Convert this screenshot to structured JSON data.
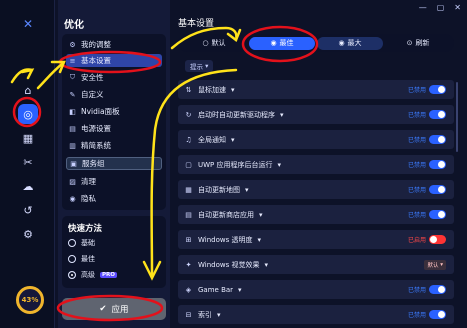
{
  "window": {
    "minimize": "—",
    "maximize": "▢",
    "close": "✕"
  },
  "rail": {
    "logo": "✕",
    "percent": "43%"
  },
  "menu": {
    "title": "优化",
    "items": [
      {
        "label": "我的调整",
        "icon": "gear-icon"
      },
      {
        "label": "基本设置",
        "icon": "sliders-icon"
      },
      {
        "label": "安全性",
        "icon": "shield-icon"
      },
      {
        "label": "自定义",
        "icon": "brush-icon"
      },
      {
        "label": "Nvidia面板",
        "icon": "nvidia-icon"
      },
      {
        "label": "电源设置",
        "icon": "power-icon"
      },
      {
        "label": "精简系统",
        "icon": "broom-icon"
      },
      {
        "label": "服务组",
        "icon": "services-icon"
      },
      {
        "label": "清理",
        "icon": "trash-icon"
      },
      {
        "label": "隐私",
        "icon": "eye-icon"
      }
    ]
  },
  "quick": {
    "title": "快速方法",
    "options": [
      {
        "label": "基础"
      },
      {
        "label": "最佳"
      },
      {
        "label": "高级"
      }
    ],
    "pro_badge": "PRO"
  },
  "apply_label": "应用",
  "main": {
    "title": "基本设置",
    "modes": [
      {
        "label": "默认"
      },
      {
        "label": "最佳"
      },
      {
        "label": "最大"
      },
      {
        "label": "刷新"
      }
    ],
    "tip": "提示",
    "rows": [
      {
        "label": "鼠标加速",
        "status": "已禁用",
        "toggle": "on"
      },
      {
        "label": "启动时自动更新驱动程序",
        "status": "已禁用",
        "toggle": "on"
      },
      {
        "label": "全局通知",
        "status": "已禁用",
        "toggle": "on"
      },
      {
        "label": "UWP 应用程序后台运行",
        "status": "已禁用",
        "toggle": "on"
      },
      {
        "label": "自动更新地图",
        "status": "已禁用",
        "toggle": "on"
      },
      {
        "label": "自动更新商店应用",
        "status": "已禁用",
        "toggle": "on"
      },
      {
        "label": "Windows 透明度",
        "status": "已启用",
        "toggle": "off"
      },
      {
        "label": "Windows 视觉效果",
        "status": "",
        "dropdown": "默认"
      },
      {
        "label": "Game Bar",
        "status": "已禁用",
        "toggle": "on"
      },
      {
        "label": "索引",
        "status": "已禁用",
        "toggle": "on"
      }
    ]
  },
  "colors": {
    "accent": "#2a61ff",
    "annotation_red": "#e3111b",
    "annotation_yellow": "#ffe21a",
    "ring": "#f0b52c"
  }
}
